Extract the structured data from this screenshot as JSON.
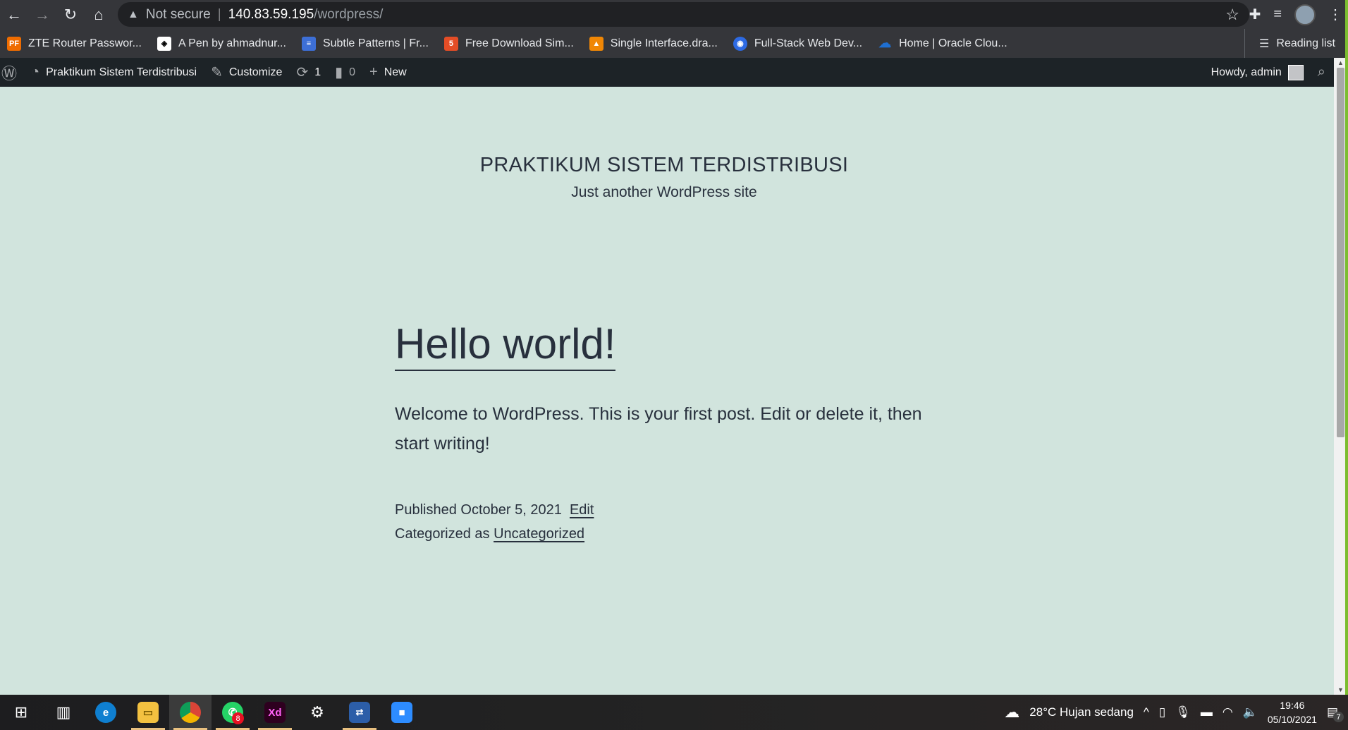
{
  "browser": {
    "security_label": "Not secure",
    "url_host": "140.83.59.195",
    "url_path": "/wordpress/",
    "bookmarks": [
      {
        "label": "ZTE Router Passwor...",
        "fav_text": "PF",
        "color": "#ef6c00"
      },
      {
        "label": "A Pen by ahmadnur...",
        "fav_text": "◈",
        "color": "#ffffff"
      },
      {
        "label": "Subtle Patterns | Fr...",
        "fav_text": "≡",
        "color": "#3d6fd6"
      },
      {
        "label": "Free Download Sim...",
        "fav_text": "5",
        "color": "#e44d26"
      },
      {
        "label": "Single Interface.dra...",
        "fav_text": "▲",
        "color": "#f08705"
      },
      {
        "label": "Full-Stack Web Dev...",
        "fav_text": "◉",
        "color": "#2d6ae3"
      },
      {
        "label": "Home | Oracle Clou...",
        "fav_text": "☁",
        "color": "#1f6fd1"
      }
    ],
    "reading_list_label": "Reading list"
  },
  "adminbar": {
    "site_name": "Praktikum Sistem Terdistribusi",
    "customize": "Customize",
    "updates_count": "1",
    "comments_count": "0",
    "new_label": "New",
    "howdy": "Howdy, admin"
  },
  "site": {
    "title": "PRAKTIKUM SISTEM TERDISTRIBUSI",
    "description": "Just another WordPress site"
  },
  "post": {
    "title": "Hello world!",
    "body": "Welcome to WordPress. This is your first post. Edit or delete it, then start writing!",
    "published_prefix": "Published",
    "published_date": "October 5, 2021",
    "edit_label": "Edit",
    "categorized_prefix": "Categorized as",
    "category": "Uncategorized"
  },
  "taskbar": {
    "whatsapp_badge": "8",
    "weather": "28°C  Hujan sedang",
    "time": "19:46",
    "date": "05/10/2021",
    "notif_count": "7"
  },
  "colors": {
    "page_bg": "#d1e4dd",
    "text": "#28303d",
    "adminbar_bg": "#1d2327",
    "chrome_bg": "#35363a"
  }
}
